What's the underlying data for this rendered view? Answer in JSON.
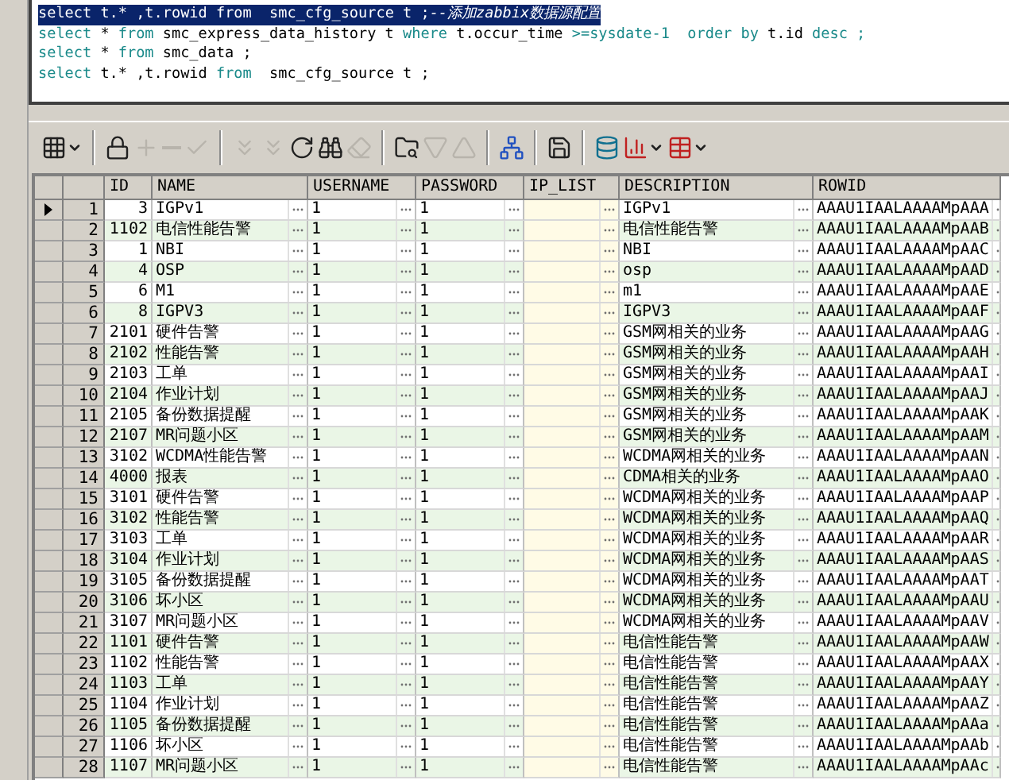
{
  "editor": {
    "lines": [
      {
        "selected": true,
        "tokens": [
          {
            "kind": "keyword",
            "text": "select"
          },
          {
            "kind": "plain",
            "text": " t.* ,t.rowid "
          },
          {
            "kind": "keyword",
            "text": "from"
          },
          {
            "kind": "plain",
            "text": "  smc_cfg_source t ;"
          },
          {
            "kind": "comment",
            "text": "--添加zabbix数据源配置"
          }
        ]
      },
      {
        "selected": false,
        "tokens": [
          {
            "kind": "keyword",
            "text": "select"
          },
          {
            "kind": "plain",
            "text": " * "
          },
          {
            "kind": "keyword",
            "text": "from"
          },
          {
            "kind": "plain",
            "text": " smc_express_data_history t "
          },
          {
            "kind": "keyword",
            "text": "where"
          },
          {
            "kind": "plain",
            "text": " t.occur_time "
          },
          {
            "kind": "keyword",
            "text": ">=sysdate-1"
          },
          {
            "kind": "keyword",
            "text": "  order by"
          },
          {
            "kind": "plain",
            "text": " t.id "
          },
          {
            "kind": "keyword",
            "text": "desc ;"
          }
        ]
      },
      {
        "selected": false,
        "tokens": [
          {
            "kind": "keyword",
            "text": "select"
          },
          {
            "kind": "plain",
            "text": " * "
          },
          {
            "kind": "keyword",
            "text": "from"
          },
          {
            "kind": "plain",
            "text": " smc_data ;"
          }
        ]
      },
      {
        "selected": false,
        "tokens": [
          {
            "kind": "keyword",
            "text": "select"
          },
          {
            "kind": "plain",
            "text": " t.* ,t.rowid "
          },
          {
            "kind": "keyword",
            "text": "from"
          },
          {
            "kind": "plain",
            "text": "  smc_cfg_source t ;"
          }
        ]
      }
    ]
  },
  "toolbar": [
    {
      "kind": "grid",
      "disabled": false,
      "dropdown": true
    },
    {
      "kind": "separator"
    },
    {
      "kind": "lock",
      "disabled": false
    },
    {
      "kind": "plus",
      "disabled": true
    },
    {
      "kind": "minus",
      "disabled": true
    },
    {
      "kind": "check",
      "disabled": true
    },
    {
      "kind": "separator"
    },
    {
      "kind": "post",
      "disabled": true
    },
    {
      "kind": "cancel",
      "disabled": true
    },
    {
      "kind": "refresh",
      "disabled": false
    },
    {
      "kind": "binoculars",
      "disabled": false
    },
    {
      "kind": "eraser",
      "disabled": true
    },
    {
      "kind": "separator"
    },
    {
      "kind": "query",
      "disabled": false
    },
    {
      "kind": "down",
      "disabled": true
    },
    {
      "kind": "up",
      "disabled": true
    },
    {
      "kind": "separator"
    },
    {
      "kind": "tree",
      "disabled": false
    },
    {
      "kind": "separator"
    },
    {
      "kind": "save",
      "disabled": false
    },
    {
      "kind": "separator"
    },
    {
      "kind": "database",
      "disabled": false
    },
    {
      "kind": "chart",
      "disabled": false,
      "dropdown": true
    },
    {
      "kind": "table",
      "disabled": false,
      "dropdown": true
    }
  ],
  "grid": {
    "columns": [
      "ID",
      "NAME",
      "USERNAME",
      "PASSWORD",
      "IP_LIST",
      "DESCRIPTION",
      "ROWID"
    ],
    "rows": [
      {
        "selected": true,
        "row_number": "1",
        "id": "3",
        "name": "IGPv1",
        "username": "1",
        "password": "1",
        "description": "IGPv1",
        "rowid": "AAAU1IAALAAAAMpAAA"
      },
      {
        "selected": false,
        "row_number": "2",
        "id": "1102",
        "name": "电信性能告警",
        "username": "1",
        "password": "1",
        "description": "电信性能告警",
        "rowid": "AAAU1IAALAAAAMpAAB"
      },
      {
        "selected": false,
        "row_number": "3",
        "id": "1",
        "name": "NBI",
        "username": "1",
        "password": "1",
        "description": "NBI",
        "rowid": "AAAU1IAALAAAAMpAAC"
      },
      {
        "selected": false,
        "row_number": "4",
        "id": "4",
        "name": "OSP",
        "username": "1",
        "password": "1",
        "description": "osp",
        "rowid": "AAAU1IAALAAAAMpAAD"
      },
      {
        "selected": false,
        "row_number": "5",
        "id": "6",
        "name": "M1",
        "username": "1",
        "password": "1",
        "description": "m1",
        "rowid": "AAAU1IAALAAAAMpAAE"
      },
      {
        "selected": false,
        "row_number": "6",
        "id": "8",
        "name": "IGPV3",
        "username": "1",
        "password": "1",
        "description": "IGPV3",
        "rowid": "AAAU1IAALAAAAMpAAF"
      },
      {
        "selected": false,
        "row_number": "7",
        "id": "2101",
        "name": "硬件告警",
        "username": "1",
        "password": "1",
        "description": "GSM网相关的业务",
        "rowid": "AAAU1IAALAAAAMpAAG"
      },
      {
        "selected": false,
        "row_number": "8",
        "id": "2102",
        "name": "性能告警",
        "username": "1",
        "password": "1",
        "description": "GSM网相关的业务",
        "rowid": "AAAU1IAALAAAAMpAAH"
      },
      {
        "selected": false,
        "row_number": "9",
        "id": "2103",
        "name": "工单",
        "username": "1",
        "password": "1",
        "description": "GSM网相关的业务",
        "rowid": "AAAU1IAALAAAAMpAAI"
      },
      {
        "selected": false,
        "row_number": "10",
        "id": "2104",
        "name": "作业计划",
        "username": "1",
        "password": "1",
        "description": "GSM网相关的业务",
        "rowid": "AAAU1IAALAAAAMpAAJ"
      },
      {
        "selected": false,
        "row_number": "11",
        "id": "2105",
        "name": "备份数据提醒",
        "username": "1",
        "password": "1",
        "description": "GSM网相关的业务",
        "rowid": "AAAU1IAALAAAAMpAAK"
      },
      {
        "selected": false,
        "row_number": "12",
        "id": "2107",
        "name": "MR问题小区",
        "username": "1",
        "password": "1",
        "description": "GSM网相关的业务",
        "rowid": "AAAU1IAALAAAAMpAAM"
      },
      {
        "selected": false,
        "row_number": "13",
        "id": "3102",
        "name": "WCDMA性能告警",
        "username": "1",
        "password": "1",
        "description": "WCDMA网相关的业务",
        "rowid": "AAAU1IAALAAAAMpAAN"
      },
      {
        "selected": false,
        "row_number": "14",
        "id": "4000",
        "name": "报表",
        "username": "1",
        "password": "1",
        "description": "CDMA相关的业务",
        "rowid": "AAAU1IAALAAAAMpAAO"
      },
      {
        "selected": false,
        "row_number": "15",
        "id": "3101",
        "name": "硬件告警",
        "username": "1",
        "password": "1",
        "description": "WCDMA网相关的业务",
        "rowid": "AAAU1IAALAAAAMpAAP"
      },
      {
        "selected": false,
        "row_number": "16",
        "id": "3102",
        "name": "性能告警",
        "username": "1",
        "password": "1",
        "description": "WCDMA网相关的业务",
        "rowid": "AAAU1IAALAAAAMpAAQ"
      },
      {
        "selected": false,
        "row_number": "17",
        "id": "3103",
        "name": "工单",
        "username": "1",
        "password": "1",
        "description": "WCDMA网相关的业务",
        "rowid": "AAAU1IAALAAAAMpAAR"
      },
      {
        "selected": false,
        "row_number": "18",
        "id": "3104",
        "name": "作业计划",
        "username": "1",
        "password": "1",
        "description": "WCDMA网相关的业务",
        "rowid": "AAAU1IAALAAAAMpAAS"
      },
      {
        "selected": false,
        "row_number": "19",
        "id": "3105",
        "name": "备份数据提醒",
        "username": "1",
        "password": "1",
        "description": "WCDMA网相关的业务",
        "rowid": "AAAU1IAALAAAAMpAAT"
      },
      {
        "selected": false,
        "row_number": "20",
        "id": "3106",
        "name": "坏小区",
        "username": "1",
        "password": "1",
        "description": "WCDMA网相关的业务",
        "rowid": "AAAU1IAALAAAAMpAAU"
      },
      {
        "selected": false,
        "row_number": "21",
        "id": "3107",
        "name": "MR问题小区",
        "username": "1",
        "password": "1",
        "description": "WCDMA网相关的业务",
        "rowid": "AAAU1IAALAAAAMpAAV"
      },
      {
        "selected": false,
        "row_number": "22",
        "id": "1101",
        "name": "硬件告警",
        "username": "1",
        "password": "1",
        "description": "电信性能告警",
        "rowid": "AAAU1IAALAAAAMpAAW"
      },
      {
        "selected": false,
        "row_number": "23",
        "id": "1102",
        "name": "性能告警",
        "username": "1",
        "password": "1",
        "description": "电信性能告警",
        "rowid": "AAAU1IAALAAAAMpAAX"
      },
      {
        "selected": false,
        "row_number": "24",
        "id": "1103",
        "name": "工单",
        "username": "1",
        "password": "1",
        "description": "电信性能告警",
        "rowid": "AAAU1IAALAAAAMpAAY"
      },
      {
        "selected": false,
        "row_number": "25",
        "id": "1104",
        "name": "作业计划",
        "username": "1",
        "password": "1",
        "description": "电信性能告警",
        "rowid": "AAAU1IAALAAAAMpAAZ"
      },
      {
        "selected": false,
        "row_number": "26",
        "id": "1105",
        "name": "备份数据提醒",
        "username": "1",
        "password": "1",
        "description": "电信性能告警",
        "rowid": "AAAU1IAALAAAAMpAAa"
      },
      {
        "selected": false,
        "row_number": "27",
        "id": "1106",
        "name": "坏小区",
        "username": "1",
        "password": "1",
        "description": "电信性能告警",
        "rowid": "AAAU1IAALAAAAMpAAb"
      },
      {
        "selected": false,
        "row_number": "28",
        "id": "1107",
        "name": "MR问题小区",
        "username": "1",
        "password": "1",
        "description": "电信性能告警",
        "rowid": "AAAU1IAALAAAAMpAAc"
      }
    ]
  }
}
